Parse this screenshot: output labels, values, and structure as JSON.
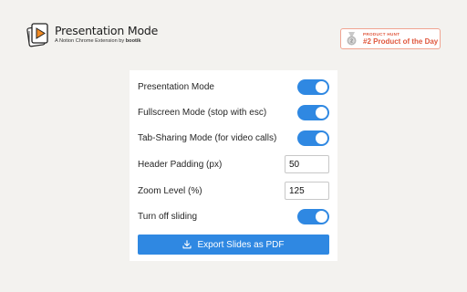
{
  "header": {
    "title": "Presentation Mode",
    "subtitle": "A Notion Chrome Extension by",
    "subtitle_brand": "bootik",
    "logo_icon": "slides-play-icon"
  },
  "badge": {
    "label": "PRODUCT HUNT",
    "award": "#2 Product of the Day",
    "icon": "medal-icon",
    "accent": "#e0593f"
  },
  "settings": {
    "presentation_mode": {
      "label": "Presentation Mode",
      "on": true
    },
    "fullscreen_mode": {
      "label": "Fullscreen Mode (stop with esc)",
      "on": true
    },
    "tab_sharing_mode": {
      "label": "Tab-Sharing Mode (for video calls)",
      "on": true
    },
    "header_padding": {
      "label": "Header Padding (px)",
      "value": "50"
    },
    "zoom_level": {
      "label": "Zoom Level (%)",
      "value": "125"
    },
    "turn_off_sliding": {
      "label": "Turn off sliding",
      "on": true
    }
  },
  "export_button": {
    "label": "Export Slides as PDF",
    "icon": "download-icon"
  },
  "colors": {
    "accent": "#2f88e2",
    "background": "#f3f2ef",
    "card": "#ffffff"
  }
}
